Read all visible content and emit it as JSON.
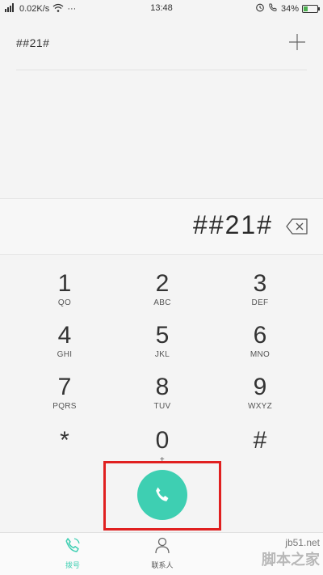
{
  "status_bar": {
    "speed": "0.02K/s",
    "dots": "···",
    "time": "13:48",
    "battery": "34%",
    "battery_level": 0.34
  },
  "search": {
    "value": "##21#"
  },
  "dialer": {
    "number": "##21#"
  },
  "keypad": [
    {
      "digit": "1",
      "letters": "QO"
    },
    {
      "digit": "2",
      "letters": "ABC"
    },
    {
      "digit": "3",
      "letters": "DEF"
    },
    {
      "digit": "4",
      "letters": "GHI"
    },
    {
      "digit": "5",
      "letters": "JKL"
    },
    {
      "digit": "6",
      "letters": "MNO"
    },
    {
      "digit": "7",
      "letters": "PQRS"
    },
    {
      "digit": "8",
      "letters": "TUV"
    },
    {
      "digit": "9",
      "letters": "WXYZ"
    },
    {
      "digit": "*",
      "letters": ""
    },
    {
      "digit": "0",
      "letters": "+"
    },
    {
      "digit": "#",
      "letters": ""
    }
  ],
  "nav": {
    "dial": "拨号",
    "contacts": "联系人"
  },
  "watermark": {
    "url": "jb51.net",
    "brand": "脚本之家"
  },
  "colors": {
    "accent": "#3ecfb2",
    "highlight_box": "#e02020"
  }
}
